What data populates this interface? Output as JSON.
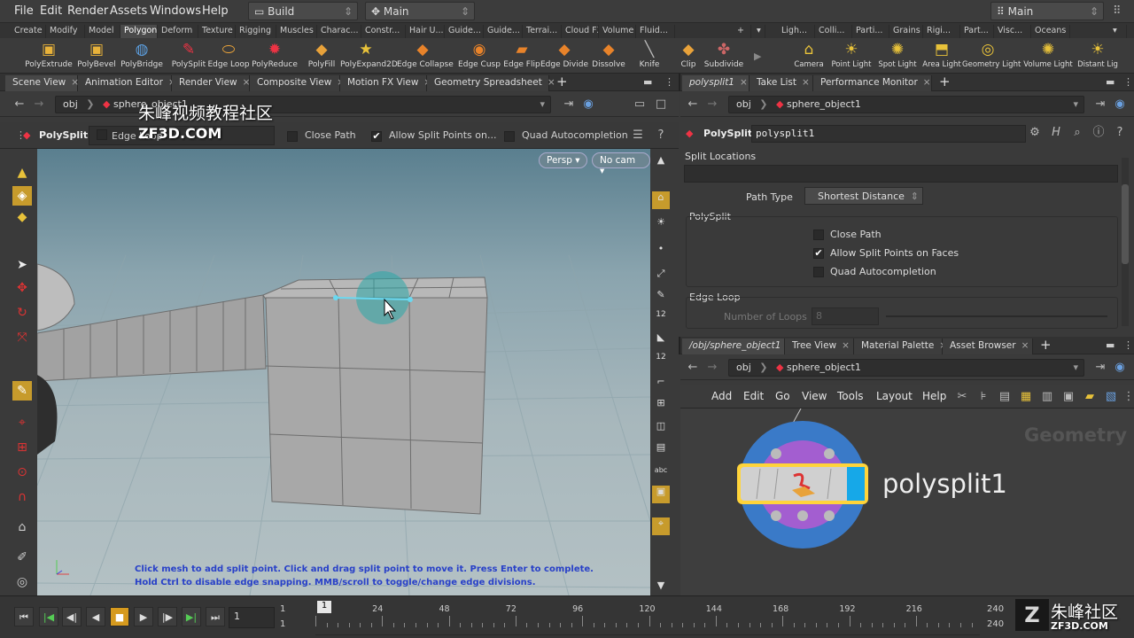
{
  "menu": [
    "File",
    "Edit",
    "Render",
    "Assets",
    "Windows",
    "Help"
  ],
  "desktop": "Build",
  "context": "Main",
  "context_right": "Main",
  "shelf_tabs": [
    "Create",
    "Modify",
    "Model",
    "Polygon",
    "Deform",
    "Texture",
    "Rigging",
    "Muscles",
    "Charac...",
    "Constr...",
    "Hair U...",
    "Guide...",
    "Guide...",
    "Terrai...",
    "Cloud FX",
    "Volume",
    "Fluid..."
  ],
  "shelf_tabs2": [
    "Ligh...",
    "Colli...",
    "Parti...",
    "Grains",
    "Rigi...",
    "Part...",
    "Visc...",
    "Oceans"
  ],
  "tools": [
    "PolyExtrude",
    "PolyBevel",
    "PolyBridge",
    "PolySplit",
    "Edge Loop",
    "PolyReduce",
    "PolyFill",
    "PolyExpand2D",
    "Edge Collapse",
    "Edge Cusp",
    "Edge Flip",
    "Edge Divide",
    "Dissolve",
    "Knife",
    "Clip",
    "Subdivide"
  ],
  "tools2": [
    "Camera",
    "Point Light",
    "Spot Light",
    "Area Light",
    "Geometry Light",
    "Volume Light",
    "Distant Lig"
  ],
  "left_tabs": [
    "Scene View",
    "Animation Editor",
    "Render View",
    "Composite View",
    "Motion FX View",
    "Geometry Spreadsheet"
  ],
  "left_path": {
    "root": "obj",
    "node": "sphere_object1"
  },
  "tool_bar": {
    "name": "PolySplit",
    "mode": "Edge Loop",
    "close_path": "Close Path",
    "allow_split": "Allow Split Points on...",
    "quad": "Quad Autocompletion"
  },
  "viewport": {
    "persp": "Persp",
    "cam": "No cam",
    "help1": "Click mesh to add split point. Click and drag split point to move it. Press Enter to complete.",
    "help2": "Hold Ctrl to disable edge snapping. MMB/scroll to toggle/change edge divisions."
  },
  "watermark": {
    "line1": "朱峰视频教程社区",
    "line2": "ZF3D.COM",
    "br1": "朱峰社区",
    "br2": "ZF3D.COM"
  },
  "right_tabs": [
    "polysplit1",
    "Take List",
    "Performance Monitor"
  ],
  "right_path": {
    "root": "obj",
    "node": "sphere_object1"
  },
  "params": {
    "type": "PolySplit",
    "node": "polysplit1",
    "split_locations": "Split Locations",
    "path_type_label": "Path Type",
    "path_type": "Shortest Distance",
    "section": "PolySplit",
    "close_path": "Close Path",
    "allow": "Allow Split Points on Faces",
    "quad": "Quad Autocompletion",
    "edge_loop": "Edge Loop",
    "loops_label": "Number of Loops",
    "loops": "8"
  },
  "net_tabs": [
    "/obj/sphere_object1",
    "Tree View",
    "Material Palette",
    "Asset Browser"
  ],
  "net_path": {
    "root": "obj",
    "node": "sphere_object1"
  },
  "net_menu": [
    "Add",
    "Edit",
    "Go",
    "View",
    "Tools",
    "Layout",
    "Help"
  ],
  "network": {
    "context": "Geometry",
    "node": "polysplit1"
  },
  "timeline": {
    "frame": "1",
    "start": "1",
    "start2": "1",
    "end": "240",
    "end2": "240",
    "ticks": [
      "1",
      "24",
      "48",
      "72",
      "96",
      "120",
      "144",
      "168",
      "192",
      "216",
      "240"
    ]
  }
}
